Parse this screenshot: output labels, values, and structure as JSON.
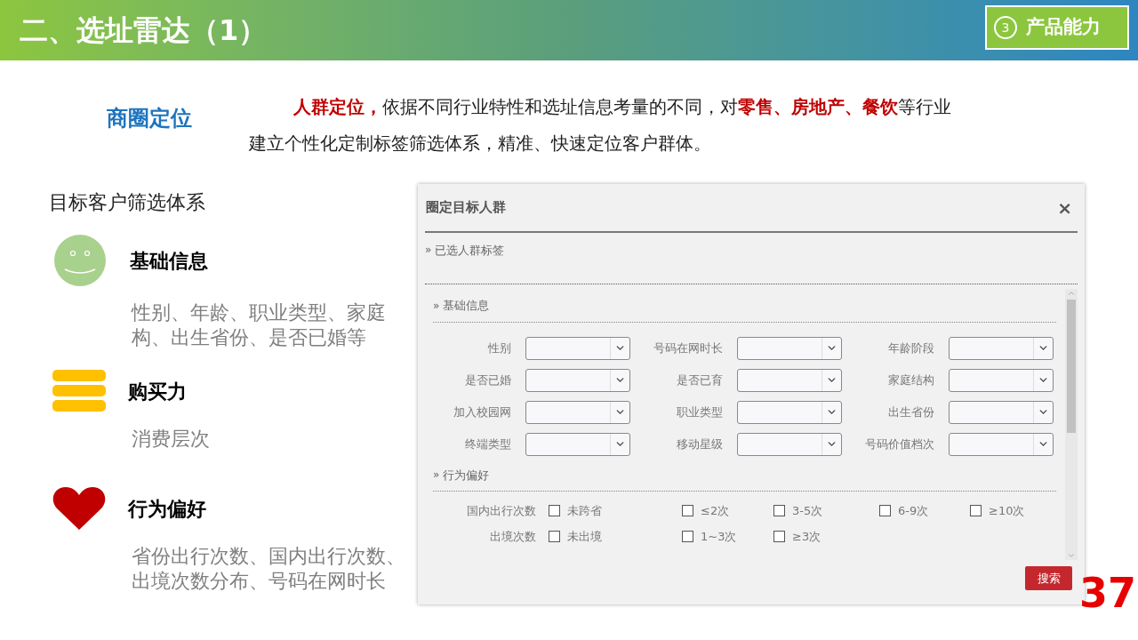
{
  "header": {
    "title": "二、选址雷达（1）",
    "badge": {
      "number": "3",
      "label": "产品能力"
    }
  },
  "intro": {
    "heading": "商圈定位",
    "text": "**人群定位，**依据不同行业特性和选址信息考量的不同，对**零售、房地产、餐饮**等行业建立个性化定制标签筛选体系，精准、快速定位客户群体。"
  },
  "filter_system": {
    "title": "目标客户筛选体系",
    "items": [
      {
        "kind": "smiley",
        "title": "基础信息",
        "lines": [
          "性别、年龄、职业类型、家庭",
          "构、出生省份、是否已婚等"
        ]
      },
      {
        "kind": "coins",
        "title": "购买力",
        "lines": [
          "消费层次"
        ]
      },
      {
        "kind": "heart",
        "title": "行为偏好",
        "lines": [
          "省份出行次数、国内出行次数、",
          "出境次数分布、号码在网时长"
        ]
      }
    ]
  },
  "dialog": {
    "title": "圈定目标人群",
    "close": "×",
    "selected_tags": {
      "marker": "»",
      "label": "已选人群标签"
    },
    "sections": [
      {
        "kind": "fields",
        "marker": "»",
        "label": "基础信息",
        "fields": [
          {
            "label": "性别"
          },
          {
            "label": "号码在网时长"
          },
          {
            "label": "年龄阶段"
          },
          {
            "label": "是否已婚"
          },
          {
            "label": "是否已育"
          },
          {
            "label": "家庭结构"
          },
          {
            "label": "加入校园网"
          },
          {
            "label": "职业类型"
          },
          {
            "label": "出生省份"
          },
          {
            "label": "终端类型"
          },
          {
            "label": "移动星级"
          },
          {
            "label": "号码价值档次"
          }
        ]
      },
      {
        "kind": "checks",
        "marker": "»",
        "label": "行为偏好",
        "rows": [
          {
            "label": "国内出行次数",
            "options": [
              {
                "label": "未跨省",
                "checked": false
              },
              {
                "label": "≤2次",
                "checked": false
              },
              {
                "label": "3-5次",
                "checked": false
              },
              {
                "label": "6-9次",
                "checked": false
              },
              {
                "label": "≥10次",
                "checked": false
              }
            ]
          },
          {
            "label": "出境次数",
            "options": [
              {
                "label": "未出境",
                "checked": false
              },
              {
                "label": "1~3次",
                "checked": false
              },
              {
                "label": "≥3次",
                "checked": false
              }
            ]
          }
        ]
      }
    ],
    "search_button": "搜索"
  },
  "page_number": "37"
}
